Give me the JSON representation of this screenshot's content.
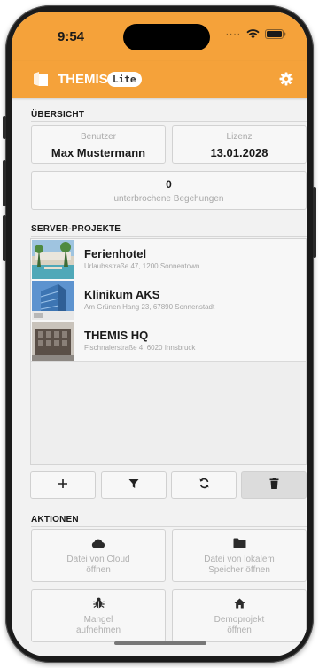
{
  "status": {
    "time": "9:54"
  },
  "app": {
    "title": "THEMIS",
    "badge": "Lite"
  },
  "overview": {
    "section": "ÜBERSICHT",
    "user_label": "Benutzer",
    "user_value": "Max Mustermann",
    "license_label": "Lizenz",
    "license_value": "13.01.2028",
    "interrupted_count": "0",
    "interrupted_label": "unterbrochene Begehungen"
  },
  "projects": {
    "section": "SERVER-PROJEKTE",
    "items": [
      {
        "name": "Ferienhotel",
        "address": "Urlaubsstraße 47, 1200 Sonnentown"
      },
      {
        "name": "Klinikum AKS",
        "address": "Am Grünen Hang 23, 67890 Sonnenstadt"
      },
      {
        "name": "THEMIS HQ",
        "address": "Fischnalerstraße 4, 6020 Innsbruck"
      }
    ]
  },
  "toolbar": {
    "add_icon": "plus-icon",
    "filter_icon": "filter-icon",
    "sync_icon": "sync-icon",
    "delete_icon": "trash-icon"
  },
  "actions": {
    "section": "AKTIONEN",
    "cloud": "Datei von Cloud\nöffnen",
    "local": "Datei von lokalem\nSpeicher öffnen",
    "defect": "Mangel\naufnehmen",
    "demo": "Demoprojekt\nöffnen"
  },
  "colors": {
    "accent": "#f5a23a"
  }
}
